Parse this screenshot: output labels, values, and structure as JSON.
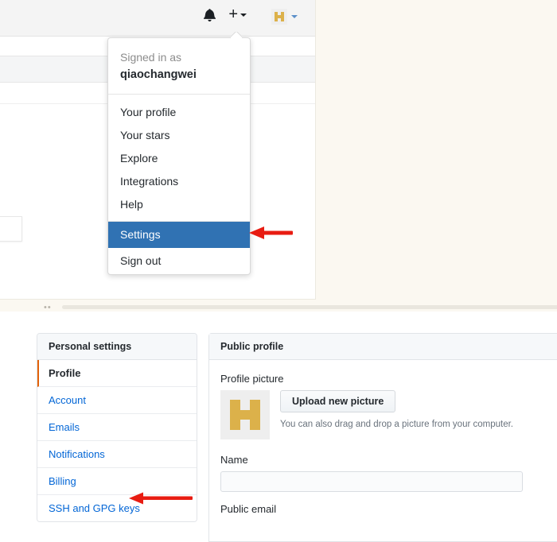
{
  "top": {
    "header": {
      "notifications_icon": "bell-icon",
      "create_new_icon": "plus-icon",
      "avatar_icon": "user-avatar-identicon"
    },
    "dropdown": {
      "signed_in_label": "Signed in as",
      "username": "qiaochangwei",
      "items": [
        {
          "label": "Your profile",
          "highlighted": false
        },
        {
          "label": "Your stars",
          "highlighted": false
        },
        {
          "label": "Explore",
          "highlighted": false
        },
        {
          "label": "Integrations",
          "highlighted": false
        },
        {
          "label": "Help",
          "highlighted": false
        }
      ],
      "settings_label": "Settings",
      "sign_out_label": "Sign out"
    }
  },
  "bottom": {
    "sidebar": {
      "header": "Personal settings",
      "items": [
        {
          "label": "Profile",
          "active": true
        },
        {
          "label": "Account",
          "active": false
        },
        {
          "label": "Emails",
          "active": false
        },
        {
          "label": "Notifications",
          "active": false
        },
        {
          "label": "Billing",
          "active": false
        },
        {
          "label": "SSH and GPG keys",
          "active": false
        }
      ]
    },
    "main": {
      "header": "Public profile",
      "profile_picture_label": "Profile picture",
      "avatar_icon": "user-avatar-identicon",
      "upload_button": "Upload new picture",
      "drag_drop_hint": "You can also drag and drop a picture from your computer.",
      "name_label": "Name",
      "name_value": "",
      "name_placeholder": "",
      "public_email_label": "Public email"
    }
  },
  "annotations": {
    "arrow_color": "#e81c12",
    "arrow_settings": "arrow-pointing-to-settings",
    "arrow_ssh_keys": "arrow-pointing-to-ssh-and-gpg-keys"
  }
}
